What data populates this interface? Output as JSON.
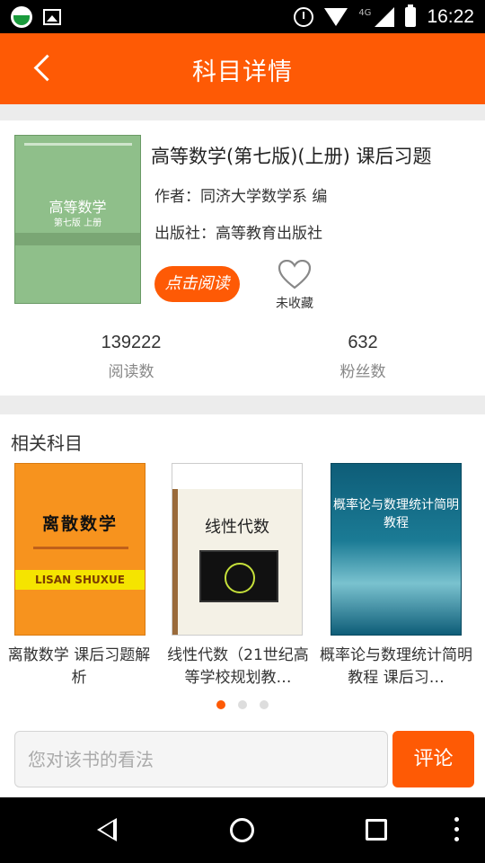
{
  "status_bar": {
    "time": "16:22",
    "network": "4G",
    "icons": [
      "app-icon",
      "image-icon",
      "alarm-icon",
      "wifi-icon",
      "signal-icon",
      "battery-icon"
    ]
  },
  "header": {
    "title": "科目详情",
    "back_icon": "arrow-left-icon"
  },
  "book": {
    "cover_title": "高等数学",
    "cover_subtitle": "第七版 上册",
    "title": "高等数学(第七版)(上册) 课后习题",
    "author": "作者：同济大学数学系 编",
    "publisher": "出版社：高等教育出版社",
    "read_button": "点击阅读",
    "favorite_label": "未收藏",
    "favorited": false,
    "stats": {
      "reads_value": "139222",
      "reads_label": "阅读数",
      "fans_value": "632",
      "fans_label": "粉丝数"
    }
  },
  "related": {
    "title": "相关科目",
    "items": [
      {
        "name": "离散数学 课后习题解析",
        "cover_title": "离散数学",
        "cover_band": "LISAN SHUXUE"
      },
      {
        "name": "线性代数（21世纪高等学校规划教…",
        "cover_title": "线性代数"
      },
      {
        "name": "概率论与数理统计简明教程 课后习…",
        "cover_title": "概率论与数理统计简明教程"
      }
    ],
    "page_count": 3,
    "active_page": 0
  },
  "comment": {
    "placeholder": "您对该书的看法",
    "value": "",
    "submit_label": "评论"
  },
  "colors": {
    "accent": "#fe5a05",
    "background": "#ececec"
  }
}
